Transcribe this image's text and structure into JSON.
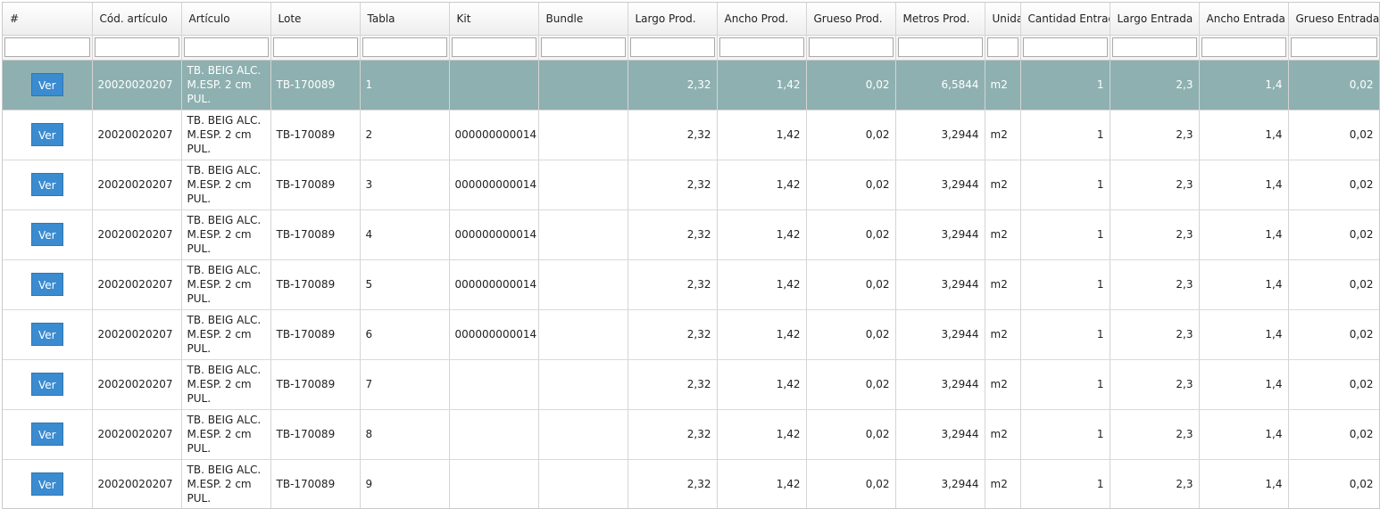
{
  "columns": [
    "#",
    "Cód. artículo",
    "Artículo",
    "Lote",
    "Tabla",
    "Kit",
    "Bundle",
    "Largo Prod.",
    "Ancho Prod.",
    "Grueso Prod.",
    "Metros Prod.",
    "Unidad",
    "Cantidad Entrada",
    "Largo Entrada",
    "Ancho Entrada",
    "Grueso Entrada"
  ],
  "action_label": "Ver",
  "rows": [
    {
      "cod": "20020020207",
      "articulo": "TB. BEIG ALC. M.ESP. 2 cm PUL.",
      "lote": "TB-170089",
      "tabla": "1",
      "kit": "",
      "bundle": "",
      "largo_prod": "2,32",
      "ancho_prod": "1,42",
      "grueso_prod": "0,02",
      "metros_prod": "6,5844",
      "unidad": "m2",
      "cantidad_entrada": "1",
      "largo_entrada": "2,3",
      "ancho_entrada": "1,4",
      "grueso_entrada": "0,02",
      "selected": true
    },
    {
      "cod": "20020020207",
      "articulo": "TB. BEIG ALC. M.ESP. 2 cm PUL.",
      "lote": "TB-170089",
      "tabla": "2",
      "kit": "000000000014",
      "bundle": "",
      "largo_prod": "2,32",
      "ancho_prod": "1,42",
      "grueso_prod": "0,02",
      "metros_prod": "3,2944",
      "unidad": "m2",
      "cantidad_entrada": "1",
      "largo_entrada": "2,3",
      "ancho_entrada": "1,4",
      "grueso_entrada": "0,02",
      "selected": false
    },
    {
      "cod": "20020020207",
      "articulo": "TB. BEIG ALC. M.ESP. 2 cm PUL.",
      "lote": "TB-170089",
      "tabla": "3",
      "kit": "000000000014",
      "bundle": "",
      "largo_prod": "2,32",
      "ancho_prod": "1,42",
      "grueso_prod": "0,02",
      "metros_prod": "3,2944",
      "unidad": "m2",
      "cantidad_entrada": "1",
      "largo_entrada": "2,3",
      "ancho_entrada": "1,4",
      "grueso_entrada": "0,02",
      "selected": false
    },
    {
      "cod": "20020020207",
      "articulo": "TB. BEIG ALC. M.ESP. 2 cm PUL.",
      "lote": "TB-170089",
      "tabla": "4",
      "kit": "000000000014",
      "bundle": "",
      "largo_prod": "2,32",
      "ancho_prod": "1,42",
      "grueso_prod": "0,02",
      "metros_prod": "3,2944",
      "unidad": "m2",
      "cantidad_entrada": "1",
      "largo_entrada": "2,3",
      "ancho_entrada": "1,4",
      "grueso_entrada": "0,02",
      "selected": false
    },
    {
      "cod": "20020020207",
      "articulo": "TB. BEIG ALC. M.ESP. 2 cm PUL.",
      "lote": "TB-170089",
      "tabla": "5",
      "kit": "000000000014",
      "bundle": "",
      "largo_prod": "2,32",
      "ancho_prod": "1,42",
      "grueso_prod": "0,02",
      "metros_prod": "3,2944",
      "unidad": "m2",
      "cantidad_entrada": "1",
      "largo_entrada": "2,3",
      "ancho_entrada": "1,4",
      "grueso_entrada": "0,02",
      "selected": false
    },
    {
      "cod": "20020020207",
      "articulo": "TB. BEIG ALC. M.ESP. 2 cm PUL.",
      "lote": "TB-170089",
      "tabla": "6",
      "kit": "000000000014",
      "bundle": "",
      "largo_prod": "2,32",
      "ancho_prod": "1,42",
      "grueso_prod": "0,02",
      "metros_prod": "3,2944",
      "unidad": "m2",
      "cantidad_entrada": "1",
      "largo_entrada": "2,3",
      "ancho_entrada": "1,4",
      "grueso_entrada": "0,02",
      "selected": false
    },
    {
      "cod": "20020020207",
      "articulo": "TB. BEIG ALC. M.ESP. 2 cm PUL.",
      "lote": "TB-170089",
      "tabla": "7",
      "kit": "",
      "bundle": "",
      "largo_prod": "2,32",
      "ancho_prod": "1,42",
      "grueso_prod": "0,02",
      "metros_prod": "3,2944",
      "unidad": "m2",
      "cantidad_entrada": "1",
      "largo_entrada": "2,3",
      "ancho_entrada": "1,4",
      "grueso_entrada": "0,02",
      "selected": false
    },
    {
      "cod": "20020020207",
      "articulo": "TB. BEIG ALC. M.ESP. 2 cm PUL.",
      "lote": "TB-170089",
      "tabla": "8",
      "kit": "",
      "bundle": "",
      "largo_prod": "2,32",
      "ancho_prod": "1,42",
      "grueso_prod": "0,02",
      "metros_prod": "3,2944",
      "unidad": "m2",
      "cantidad_entrada": "1",
      "largo_entrada": "2,3",
      "ancho_entrada": "1,4",
      "grueso_entrada": "0,02",
      "selected": false
    },
    {
      "cod": "20020020207",
      "articulo": "TB. BEIG ALC. M.ESP. 2 cm PUL.",
      "lote": "TB-170089",
      "tabla": "9",
      "kit": "",
      "bundle": "",
      "largo_prod": "2,32",
      "ancho_prod": "1,42",
      "grueso_prod": "0,02",
      "metros_prod": "3,2944",
      "unidad": "m2",
      "cantidad_entrada": "1",
      "largo_entrada": "2,3",
      "ancho_entrada": "1,4",
      "grueso_entrada": "0,02",
      "selected": false
    }
  ],
  "colors": {
    "selected_row": "#8fb0b0",
    "button": "#3b8bd0"
  }
}
